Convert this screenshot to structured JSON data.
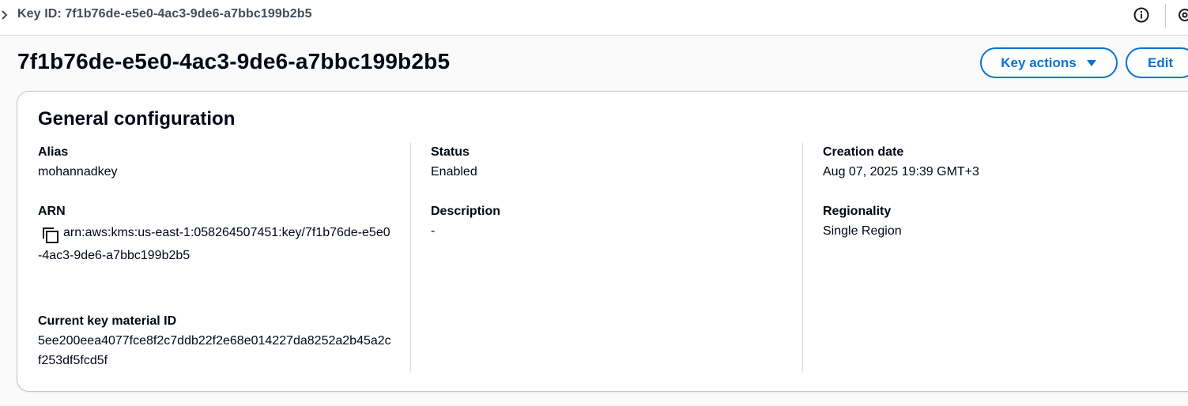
{
  "breadcrumb": {
    "label": "Key ID: 7f1b76de-e5e0-4ac3-9de6-a7bbc199b2b5"
  },
  "page": {
    "title": "7f1b76de-e5e0-4ac3-9de6-a7bbc199b2b5"
  },
  "actions": {
    "key_actions_label": "Key actions",
    "edit_label": "Edit"
  },
  "card": {
    "title": "General configuration",
    "alias": {
      "label": "Alias",
      "value": "mohannadkey"
    },
    "arn": {
      "label": "ARN",
      "value": "arn:aws:kms:us-east-1:058264507451:key/7f1b76de-e5e0-4ac3-9de6-a7bbc199b2b5"
    },
    "key_material": {
      "label": "Current key material ID",
      "value": "5ee200eea4077fce8f2c7ddb22f2e68e014227da8252a2b45a2cf253df5fcd5f"
    },
    "status": {
      "label": "Status",
      "value": "Enabled"
    },
    "description": {
      "label": "Description",
      "value": "-"
    },
    "creation_date": {
      "label": "Creation date",
      "value": "Aug 07, 2025 19:39 GMT+3"
    },
    "regionality": {
      "label": "Regionality",
      "value": "Single Region"
    }
  },
  "icons": {
    "crumb": "chevron-right-icon",
    "info": "info-icon",
    "settings": "settings-icon",
    "caret": "caret-down-icon",
    "copy": "copy-icon"
  },
  "colors": {
    "accent": "#0972d3",
    "text": "#000716",
    "border": "#c6c6cd"
  }
}
